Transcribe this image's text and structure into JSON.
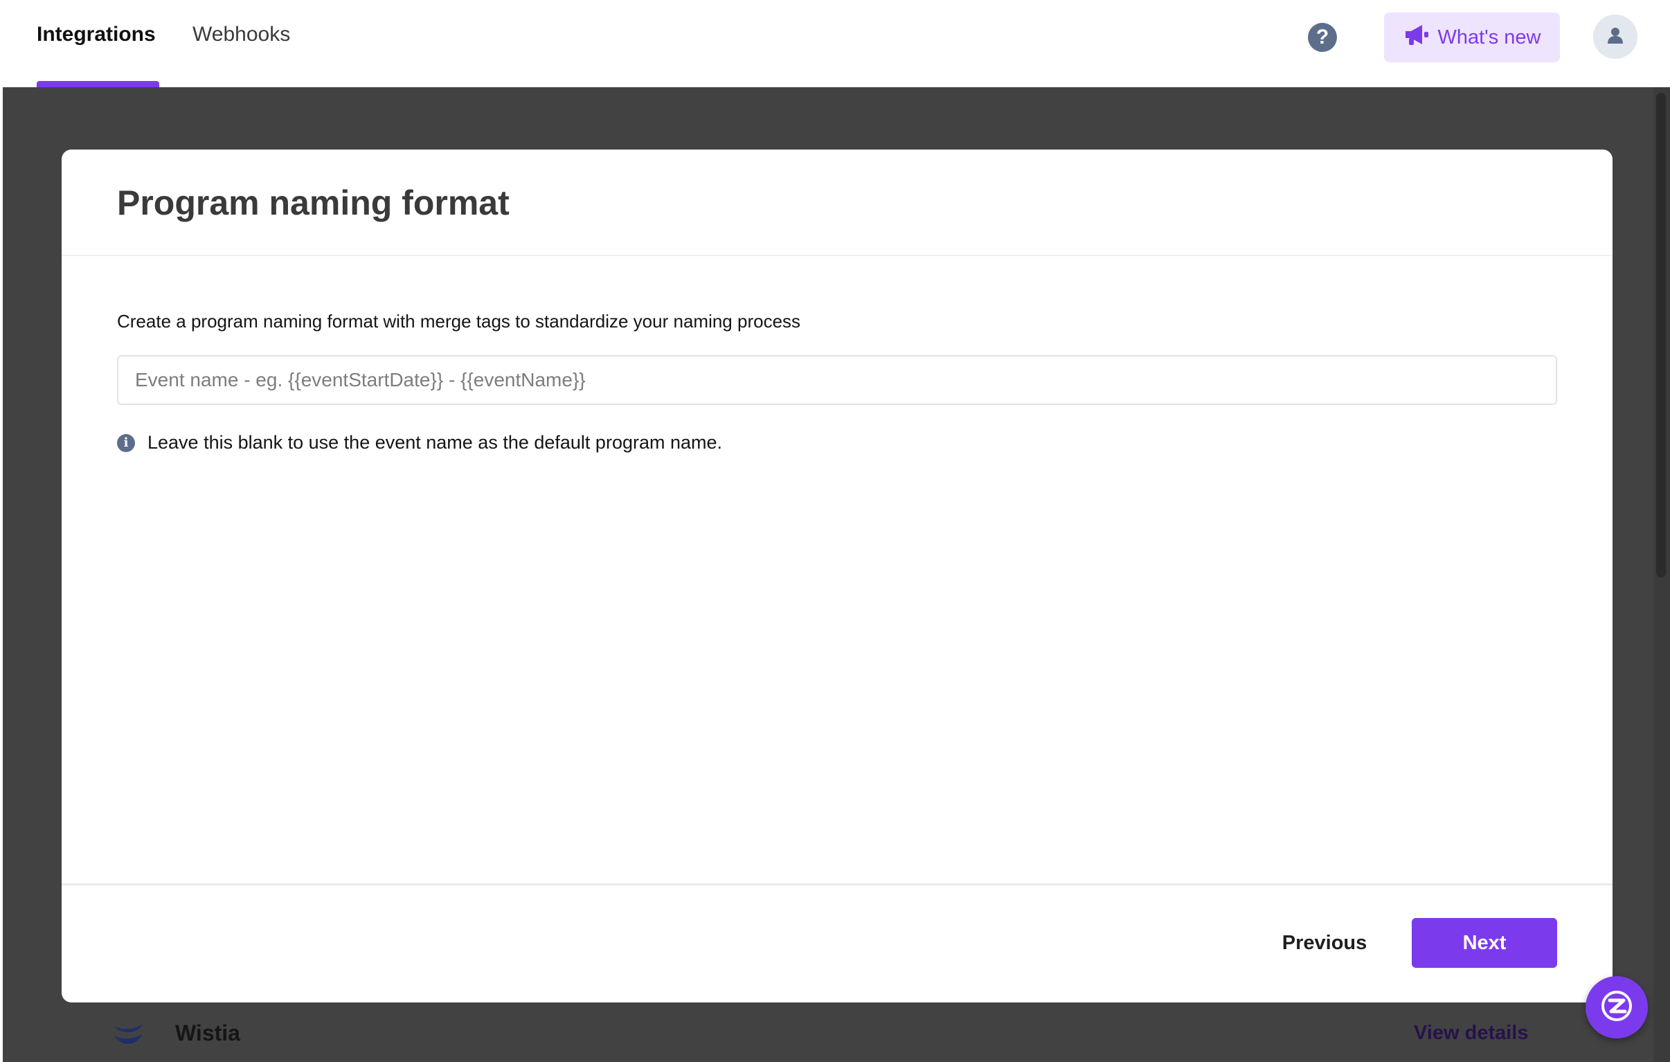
{
  "topbar": {
    "tabs": [
      {
        "label": "Integrations",
        "active": true
      },
      {
        "label": "Webhooks",
        "active": false
      }
    ],
    "help_icon_glyph": "?",
    "whats_new_label": "What's new",
    "accent_color": "#7c3aed"
  },
  "background_row": {
    "name": "Wistia",
    "link": "View details"
  },
  "modal": {
    "title": "Program naming format",
    "description": "Create a program naming format with merge tags to standardize your naming process",
    "input": {
      "value": "",
      "placeholder": "Event name - eg. {{eventStartDate}} - {{eventName}}"
    },
    "hint": "Leave this blank to use the event name as the default program name.",
    "buttons": {
      "previous": "Previous",
      "next": "Next"
    }
  },
  "icons": [
    "help-icon",
    "megaphone-icon",
    "user-icon",
    "info-icon",
    "wistia-logo-icon",
    "chat-launcher-icon"
  ]
}
